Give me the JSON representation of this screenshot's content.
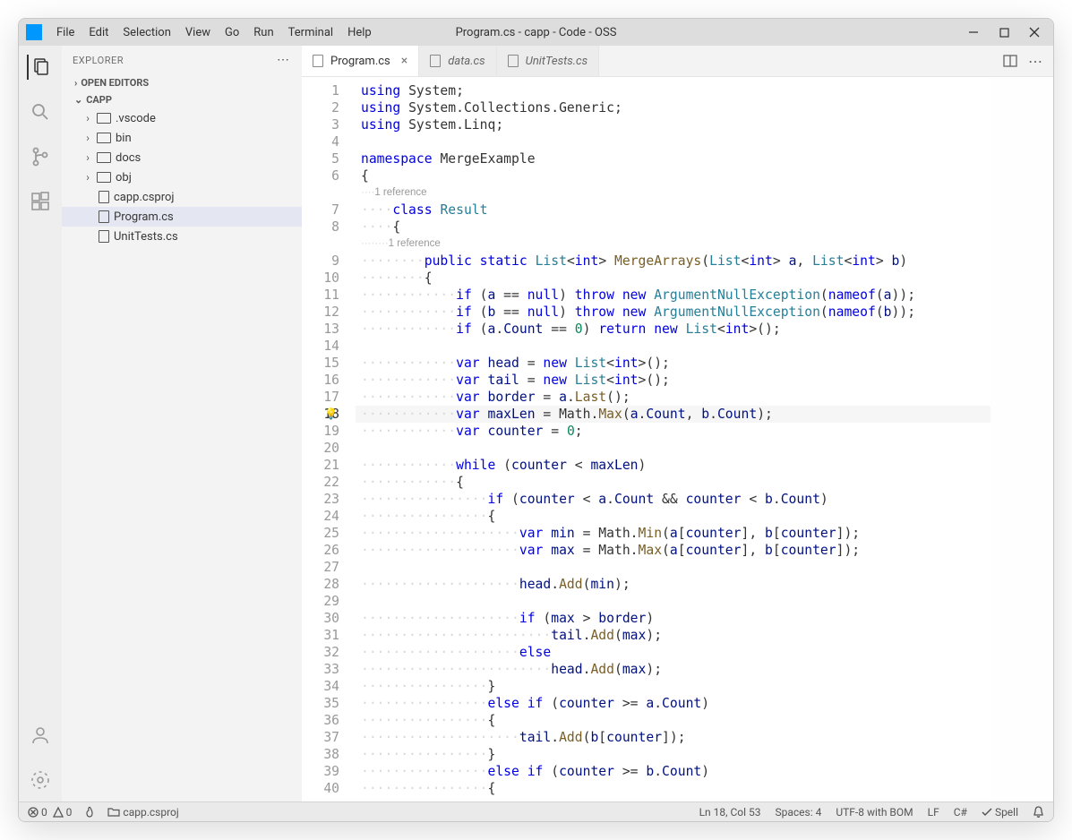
{
  "window": {
    "title": "Program.cs - capp - Code - OSS"
  },
  "menu": {
    "items": [
      "File",
      "Edit",
      "Selection",
      "View",
      "Go",
      "Run",
      "Terminal",
      "Help"
    ]
  },
  "sidebar": {
    "title": "EXPLORER",
    "open_editors_label": "OPEN EDITORS",
    "root_label": "CAPP",
    "tree": [
      {
        "kind": "folder",
        "name": ".vscode",
        "depth": 1
      },
      {
        "kind": "folder",
        "name": "bin",
        "depth": 1
      },
      {
        "kind": "folder",
        "name": "docs",
        "depth": 1
      },
      {
        "kind": "folder",
        "name": "obj",
        "depth": 1
      },
      {
        "kind": "file",
        "name": "capp.csproj",
        "depth": 1
      },
      {
        "kind": "file",
        "name": "Program.cs",
        "depth": 1,
        "selected": true
      },
      {
        "kind": "file",
        "name": "UnitTests.cs",
        "depth": 1
      }
    ]
  },
  "tabs": [
    {
      "label": "Program.cs",
      "active": true,
      "close": true
    },
    {
      "label": "data.cs",
      "active": false,
      "close": false
    },
    {
      "label": "UnitTests.cs",
      "active": false,
      "close": false
    }
  ],
  "codelens": {
    "l1": "1 reference",
    "l2": "1 reference"
  },
  "active_line": 18,
  "code_lines": [
    {
      "n": 1,
      "indent": 0,
      "tokens": [
        [
          "kw",
          "using"
        ],
        [
          "pl",
          " "
        ],
        [
          "nm",
          "System"
        ],
        [
          "pl",
          ";"
        ]
      ]
    },
    {
      "n": 2,
      "indent": 0,
      "tokens": [
        [
          "kw",
          "using"
        ],
        [
          "pl",
          " "
        ],
        [
          "nm",
          "System"
        ],
        [
          "pl",
          "."
        ],
        [
          "nm",
          "Collections"
        ],
        [
          "pl",
          "."
        ],
        [
          "nm",
          "Generic"
        ],
        [
          "pl",
          ";"
        ]
      ]
    },
    {
      "n": 3,
      "indent": 0,
      "tokens": [
        [
          "kw",
          "using"
        ],
        [
          "pl",
          " "
        ],
        [
          "nm",
          "System"
        ],
        [
          "pl",
          "."
        ],
        [
          "nm",
          "Linq"
        ],
        [
          "pl",
          ";"
        ]
      ]
    },
    {
      "n": 4,
      "indent": 0,
      "tokens": []
    },
    {
      "n": 5,
      "indent": 0,
      "tokens": [
        [
          "kw",
          "namespace"
        ],
        [
          "pl",
          " "
        ],
        [
          "nm",
          "MergeExample"
        ]
      ]
    },
    {
      "n": 6,
      "indent": 0,
      "tokens": [
        [
          "pl",
          "{"
        ]
      ]
    },
    {
      "codelens": "l1",
      "indent": 1
    },
    {
      "n": 7,
      "indent": 1,
      "tokens": [
        [
          "kw",
          "class"
        ],
        [
          "pl",
          " "
        ],
        [
          "ty",
          "Result"
        ]
      ]
    },
    {
      "n": 8,
      "indent": 1,
      "tokens": [
        [
          "pl",
          "{"
        ]
      ]
    },
    {
      "codelens": "l2",
      "indent": 2
    },
    {
      "n": 9,
      "indent": 2,
      "tokens": [
        [
          "kw",
          "public"
        ],
        [
          "pl",
          " "
        ],
        [
          "kw",
          "static"
        ],
        [
          "pl",
          " "
        ],
        [
          "ty",
          "List"
        ],
        [
          "pl",
          "<"
        ],
        [
          "kw",
          "int"
        ],
        [
          "pl",
          "> "
        ],
        [
          "fn",
          "MergeArrays"
        ],
        [
          "pl",
          "("
        ],
        [
          "ty",
          "List"
        ],
        [
          "pl",
          "<"
        ],
        [
          "kw",
          "int"
        ],
        [
          "pl",
          "> "
        ],
        [
          "vr",
          "a"
        ],
        [
          "pl",
          ", "
        ],
        [
          "ty",
          "List"
        ],
        [
          "pl",
          "<"
        ],
        [
          "kw",
          "int"
        ],
        [
          "pl",
          "> "
        ],
        [
          "vr",
          "b"
        ],
        [
          "pl",
          ")"
        ]
      ]
    },
    {
      "n": 10,
      "indent": 2,
      "tokens": [
        [
          "pl",
          "{"
        ]
      ],
      "boxed": true
    },
    {
      "n": 11,
      "indent": 3,
      "tokens": [
        [
          "kw",
          "if"
        ],
        [
          "pl",
          " ("
        ],
        [
          "vr",
          "a"
        ],
        [
          "pl",
          " == "
        ],
        [
          "kw",
          "null"
        ],
        [
          "pl",
          ") "
        ],
        [
          "kw",
          "throw"
        ],
        [
          "pl",
          " "
        ],
        [
          "kw",
          "new"
        ],
        [
          "pl",
          " "
        ],
        [
          "ty",
          "ArgumentNullException"
        ],
        [
          "pl",
          "("
        ],
        [
          "kw",
          "nameof"
        ],
        [
          "pl",
          "("
        ],
        [
          "vr",
          "a"
        ],
        [
          "pl",
          "));"
        ]
      ]
    },
    {
      "n": 12,
      "indent": 3,
      "tokens": [
        [
          "kw",
          "if"
        ],
        [
          "pl",
          " ("
        ],
        [
          "vr",
          "b"
        ],
        [
          "pl",
          " == "
        ],
        [
          "kw",
          "null"
        ],
        [
          "pl",
          ") "
        ],
        [
          "kw",
          "throw"
        ],
        [
          "pl",
          " "
        ],
        [
          "kw",
          "new"
        ],
        [
          "pl",
          " "
        ],
        [
          "ty",
          "ArgumentNullException"
        ],
        [
          "pl",
          "("
        ],
        [
          "kw",
          "nameof"
        ],
        [
          "pl",
          "("
        ],
        [
          "vr",
          "b"
        ],
        [
          "pl",
          "));"
        ]
      ]
    },
    {
      "n": 13,
      "indent": 3,
      "tokens": [
        [
          "kw",
          "if"
        ],
        [
          "pl",
          " ("
        ],
        [
          "vr",
          "a"
        ],
        [
          "pl",
          "."
        ],
        [
          "vr",
          "Count"
        ],
        [
          "pl",
          " == "
        ],
        [
          "num",
          "0"
        ],
        [
          "pl",
          ") "
        ],
        [
          "kw",
          "return"
        ],
        [
          "pl",
          " "
        ],
        [
          "kw",
          "new"
        ],
        [
          "pl",
          " "
        ],
        [
          "ty",
          "List"
        ],
        [
          "pl",
          "<"
        ],
        [
          "kw",
          "int"
        ],
        [
          "pl",
          ">();"
        ]
      ]
    },
    {
      "n": 14,
      "indent": 0,
      "tokens": []
    },
    {
      "n": 15,
      "indent": 3,
      "tokens": [
        [
          "kw",
          "var"
        ],
        [
          "pl",
          " "
        ],
        [
          "vr",
          "head"
        ],
        [
          "pl",
          " = "
        ],
        [
          "kw",
          "new"
        ],
        [
          "pl",
          " "
        ],
        [
          "ty",
          "List"
        ],
        [
          "pl",
          "<"
        ],
        [
          "kw",
          "int"
        ],
        [
          "pl",
          ">();"
        ]
      ]
    },
    {
      "n": 16,
      "indent": 3,
      "tokens": [
        [
          "kw",
          "var"
        ],
        [
          "pl",
          " "
        ],
        [
          "vr",
          "tail"
        ],
        [
          "pl",
          " = "
        ],
        [
          "kw",
          "new"
        ],
        [
          "pl",
          " "
        ],
        [
          "ty",
          "List"
        ],
        [
          "pl",
          "<"
        ],
        [
          "kw",
          "int"
        ],
        [
          "pl",
          ">();"
        ]
      ]
    },
    {
      "n": 17,
      "indent": 3,
      "tokens": [
        [
          "kw",
          "var"
        ],
        [
          "pl",
          " "
        ],
        [
          "vr",
          "border"
        ],
        [
          "pl",
          " = "
        ],
        [
          "vr",
          "a"
        ],
        [
          "pl",
          "."
        ],
        [
          "fn",
          "Last"
        ],
        [
          "pl",
          "();"
        ]
      ]
    },
    {
      "n": 18,
      "indent": 3,
      "hl": true,
      "bulb": true,
      "tokens": [
        [
          "kw",
          "var"
        ],
        [
          "pl",
          " "
        ],
        [
          "vr",
          "maxLen"
        ],
        [
          "pl",
          " = "
        ],
        [
          "nm",
          "Math"
        ],
        [
          "pl",
          "."
        ],
        [
          "fn",
          "Max"
        ],
        [
          "pl",
          "("
        ],
        [
          "vr",
          "a"
        ],
        [
          "pl",
          "."
        ],
        [
          "vr",
          "Count"
        ],
        [
          "pl",
          ", "
        ],
        [
          "vr",
          "b"
        ],
        [
          "pl",
          "."
        ],
        [
          "vr",
          "Count"
        ],
        [
          "pl",
          ");"
        ]
      ]
    },
    {
      "n": 19,
      "indent": 3,
      "tokens": [
        [
          "kw",
          "var"
        ],
        [
          "pl",
          " "
        ],
        [
          "vr",
          "counter"
        ],
        [
          "pl",
          " = "
        ],
        [
          "num",
          "0"
        ],
        [
          "pl",
          ";"
        ]
      ]
    },
    {
      "n": 20,
      "indent": 0,
      "tokens": []
    },
    {
      "n": 21,
      "indent": 3,
      "tokens": [
        [
          "kw",
          "while"
        ],
        [
          "pl",
          " ("
        ],
        [
          "vr",
          "counter"
        ],
        [
          "pl",
          " < "
        ],
        [
          "vr",
          "maxLen"
        ],
        [
          "pl",
          ")"
        ]
      ]
    },
    {
      "n": 22,
      "indent": 3,
      "tokens": [
        [
          "pl",
          "{"
        ]
      ]
    },
    {
      "n": 23,
      "indent": 4,
      "tokens": [
        [
          "kw",
          "if"
        ],
        [
          "pl",
          " ("
        ],
        [
          "vr",
          "counter"
        ],
        [
          "pl",
          " < "
        ],
        [
          "vr",
          "a"
        ],
        [
          "pl",
          "."
        ],
        [
          "vr",
          "Count"
        ],
        [
          "pl",
          " && "
        ],
        [
          "vr",
          "counter"
        ],
        [
          "pl",
          " < "
        ],
        [
          "vr",
          "b"
        ],
        [
          "pl",
          "."
        ],
        [
          "vr",
          "Count"
        ],
        [
          "pl",
          ")"
        ]
      ]
    },
    {
      "n": 24,
      "indent": 4,
      "tokens": [
        [
          "pl",
          "{"
        ]
      ]
    },
    {
      "n": 25,
      "indent": 5,
      "tokens": [
        [
          "kw",
          "var"
        ],
        [
          "pl",
          " "
        ],
        [
          "vr",
          "min"
        ],
        [
          "pl",
          " = "
        ],
        [
          "nm",
          "Math"
        ],
        [
          "pl",
          "."
        ],
        [
          "fn",
          "Min"
        ],
        [
          "pl",
          "("
        ],
        [
          "vr",
          "a"
        ],
        [
          "pl",
          "["
        ],
        [
          "vr",
          "counter"
        ],
        [
          "pl",
          "], "
        ],
        [
          "vr",
          "b"
        ],
        [
          "pl",
          "["
        ],
        [
          "vr",
          "counter"
        ],
        [
          "pl",
          "]);"
        ]
      ]
    },
    {
      "n": 26,
      "indent": 5,
      "tokens": [
        [
          "kw",
          "var"
        ],
        [
          "pl",
          " "
        ],
        [
          "vr",
          "max"
        ],
        [
          "pl",
          " = "
        ],
        [
          "nm",
          "Math"
        ],
        [
          "pl",
          "."
        ],
        [
          "fn",
          "Max"
        ],
        [
          "pl",
          "("
        ],
        [
          "vr",
          "a"
        ],
        [
          "pl",
          "["
        ],
        [
          "vr",
          "counter"
        ],
        [
          "pl",
          "], "
        ],
        [
          "vr",
          "b"
        ],
        [
          "pl",
          "["
        ],
        [
          "vr",
          "counter"
        ],
        [
          "pl",
          "]);"
        ]
      ]
    },
    {
      "n": 27,
      "indent": 0,
      "tokens": []
    },
    {
      "n": 28,
      "indent": 5,
      "tokens": [
        [
          "vr",
          "head"
        ],
        [
          "pl",
          "."
        ],
        [
          "fn",
          "Add"
        ],
        [
          "pl",
          "("
        ],
        [
          "vr",
          "min"
        ],
        [
          "pl",
          ");"
        ]
      ]
    },
    {
      "n": 29,
      "indent": 0,
      "tokens": []
    },
    {
      "n": 30,
      "indent": 5,
      "tokens": [
        [
          "kw",
          "if"
        ],
        [
          "pl",
          " ("
        ],
        [
          "vr",
          "max"
        ],
        [
          "pl",
          " > "
        ],
        [
          "vr",
          "border"
        ],
        [
          "pl",
          ")"
        ]
      ]
    },
    {
      "n": 31,
      "indent": 6,
      "tokens": [
        [
          "vr",
          "tail"
        ],
        [
          "pl",
          "."
        ],
        [
          "fn",
          "Add"
        ],
        [
          "pl",
          "("
        ],
        [
          "vr",
          "max"
        ],
        [
          "pl",
          ");"
        ]
      ]
    },
    {
      "n": 32,
      "indent": 5,
      "tokens": [
        [
          "kw",
          "else"
        ]
      ]
    },
    {
      "n": 33,
      "indent": 6,
      "tokens": [
        [
          "vr",
          "head"
        ],
        [
          "pl",
          "."
        ],
        [
          "fn",
          "Add"
        ],
        [
          "pl",
          "("
        ],
        [
          "vr",
          "max"
        ],
        [
          "pl",
          ");"
        ]
      ]
    },
    {
      "n": 34,
      "indent": 4,
      "tokens": [
        [
          "pl",
          "}"
        ]
      ]
    },
    {
      "n": 35,
      "indent": 4,
      "tokens": [
        [
          "kw",
          "else"
        ],
        [
          "pl",
          " "
        ],
        [
          "kw",
          "if"
        ],
        [
          "pl",
          " ("
        ],
        [
          "vr",
          "counter"
        ],
        [
          "pl",
          " >= "
        ],
        [
          "vr",
          "a"
        ],
        [
          "pl",
          "."
        ],
        [
          "vr",
          "Count"
        ],
        [
          "pl",
          ")"
        ]
      ]
    },
    {
      "n": 36,
      "indent": 4,
      "tokens": [
        [
          "pl",
          "{"
        ]
      ]
    },
    {
      "n": 37,
      "indent": 5,
      "tokens": [
        [
          "vr",
          "tail"
        ],
        [
          "pl",
          "."
        ],
        [
          "fn",
          "Add"
        ],
        [
          "pl",
          "("
        ],
        [
          "vr",
          "b"
        ],
        [
          "pl",
          "["
        ],
        [
          "vr",
          "counter"
        ],
        [
          "pl",
          "]);"
        ]
      ]
    },
    {
      "n": 38,
      "indent": 4,
      "tokens": [
        [
          "pl",
          "}"
        ]
      ]
    },
    {
      "n": 39,
      "indent": 4,
      "tokens": [
        [
          "kw",
          "else"
        ],
        [
          "pl",
          " "
        ],
        [
          "kw",
          "if"
        ],
        [
          "pl",
          " ("
        ],
        [
          "vr",
          "counter"
        ],
        [
          "pl",
          " >= "
        ],
        [
          "vr",
          "b"
        ],
        [
          "pl",
          "."
        ],
        [
          "vr",
          "Count"
        ],
        [
          "pl",
          ")"
        ]
      ]
    },
    {
      "n": 40,
      "indent": 4,
      "tokens": [
        [
          "pl",
          "{"
        ]
      ]
    }
  ],
  "status": {
    "errors": "0",
    "warnings": "0",
    "project": "capp.csproj",
    "position": "Ln 18, Col 53",
    "spaces": "Spaces: 4",
    "encoding": "UTF-8 with BOM",
    "eol": "LF",
    "lang": "C#",
    "spell": "Spell"
  },
  "icons": {
    "minimize": "—",
    "maximize": "▢",
    "close": "✕",
    "dots": "⋯",
    "chev_right": "›",
    "chev_down": "⌄",
    "check": "✓",
    "bell": "🔔",
    "flame": "🔥"
  }
}
